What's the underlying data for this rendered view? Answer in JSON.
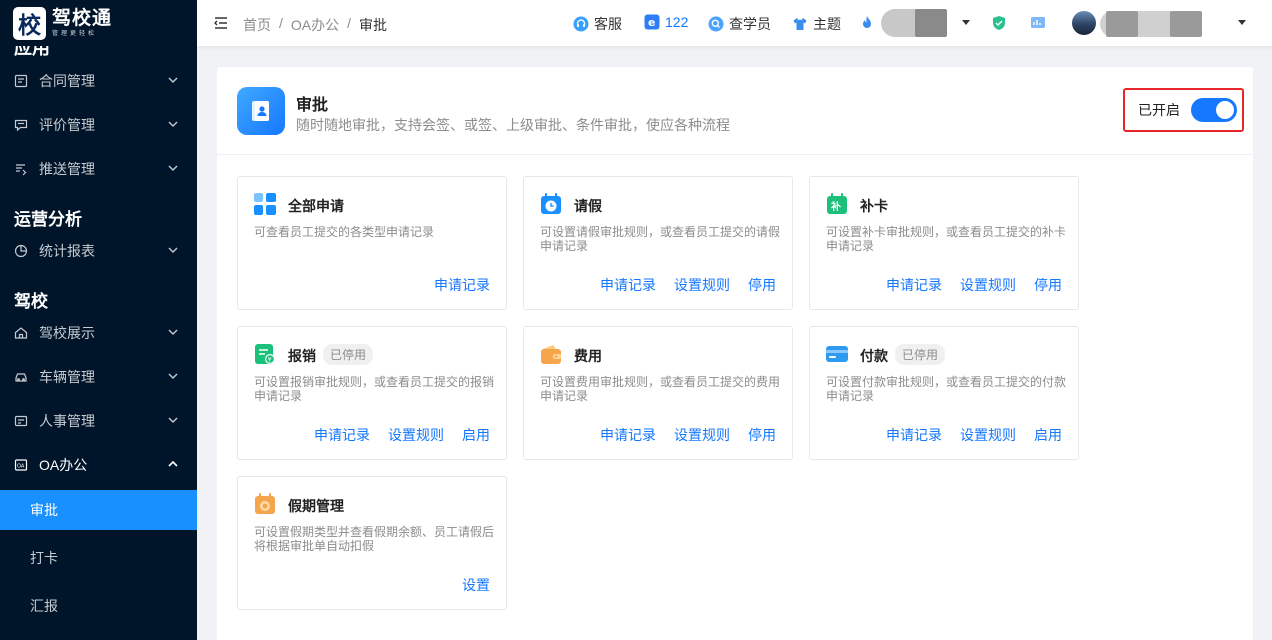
{
  "app": {
    "logo_char": "校",
    "logo_title": "驾校通",
    "logo_sub": "管理更轻松"
  },
  "sidebar": {
    "cut_heading": "应用",
    "items": [
      {
        "label": "合同管理",
        "icon": "contract-icon"
      },
      {
        "label": "评价管理",
        "icon": "comment-icon"
      },
      {
        "label": "推送管理",
        "icon": "push-icon"
      }
    ],
    "section_ops": "运营分析",
    "ops_items": [
      {
        "label": "统计报表",
        "icon": "pie-chart-icon"
      }
    ],
    "section_school": "驾校",
    "school_items": [
      {
        "label": "驾校展示",
        "icon": "home-icon"
      },
      {
        "label": "车辆管理",
        "icon": "car-icon"
      },
      {
        "label": "人事管理",
        "icon": "staff-icon"
      },
      {
        "label": "OA办公",
        "icon": "oa-icon"
      }
    ],
    "oa_sub": [
      {
        "label": "审批",
        "active": true
      },
      {
        "label": "打卡",
        "active": false
      },
      {
        "label": "汇报",
        "active": false
      }
    ]
  },
  "header": {
    "breadcrumb": [
      "首页",
      "OA办公",
      "审批"
    ],
    "separator": "/",
    "service": "客服",
    "count_122": "122",
    "student_lookup": "查学员",
    "theme": "主题"
  },
  "approval": {
    "title": "审批",
    "description": "随时随地审批，支持会签、或签、上级审批、条件审批，使应各种流程",
    "toggle_label": "已开启",
    "toggle_on": true
  },
  "cards": [
    {
      "title": "全部申请",
      "badge": "",
      "desc": "可查看员工提交的各类型申请记录",
      "actions": [
        "申请记录"
      ],
      "icon": "all-apps-icon",
      "color": "#1890ff"
    },
    {
      "title": "请假",
      "badge": "",
      "desc": "可设置请假审批规则，或查看员工提交的请假申请记录",
      "actions": [
        "申请记录",
        "设置规则",
        "停用"
      ],
      "icon": "calendar-clock-icon",
      "color": "#1890ff"
    },
    {
      "title": "补卡",
      "badge": "",
      "desc": "可设置补卡审批规则，或查看员工提交的补卡申请记录",
      "actions": [
        "申请记录",
        "设置规则",
        "停用"
      ],
      "icon": "punch-card-icon",
      "color": "#1cc07a"
    },
    {
      "title": "报销",
      "badge": "已停用",
      "desc": "可设置报销审批规则，或查看员工提交的报销申请记录",
      "actions": [
        "申请记录",
        "设置规则",
        "启用"
      ],
      "icon": "reimburse-icon",
      "color": "#1cc07a"
    },
    {
      "title": "费用",
      "badge": "",
      "desc": "可设置费用审批规则，或查看员工提交的费用申请记录",
      "actions": [
        "申请记录",
        "设置规则",
        "停用"
      ],
      "icon": "wallet-icon",
      "color": "#f5a54b"
    },
    {
      "title": "付款",
      "badge": "已停用",
      "desc": "可设置付款审批规则，或查看员工提交的付款申请记录",
      "actions": [
        "申请记录",
        "设置规则",
        "启用"
      ],
      "icon": "bank-card-icon",
      "color": "#2f9bf0"
    },
    {
      "title": "假期管理",
      "badge": "",
      "desc": "可设置假期类型并查看假期余额、员工请假后将根据审批单自动扣假",
      "actions": [
        "设置"
      ],
      "icon": "holiday-icon",
      "color": "#f5a54b"
    }
  ]
}
